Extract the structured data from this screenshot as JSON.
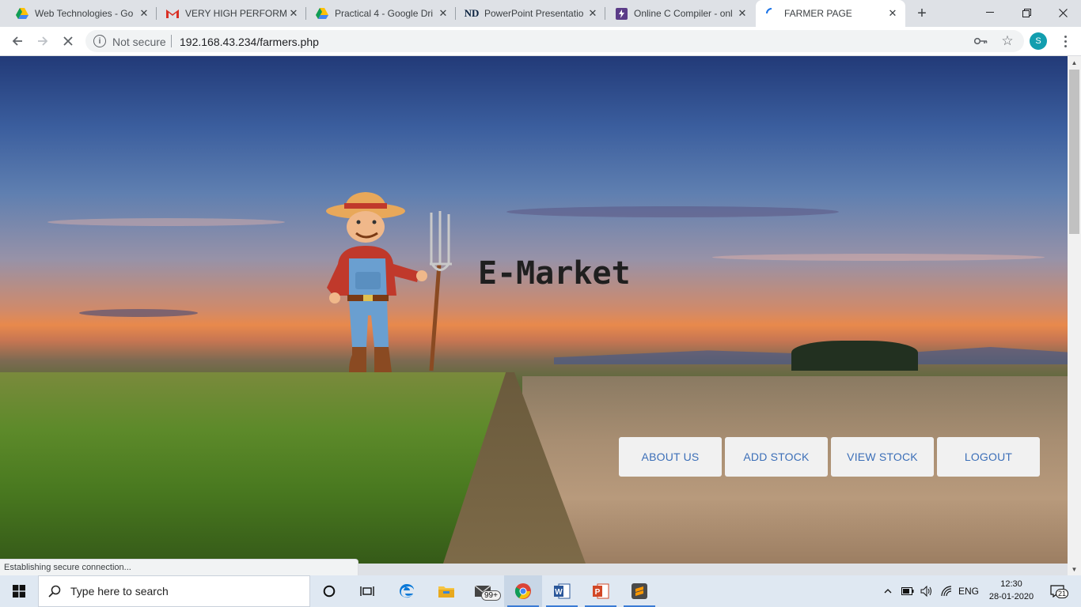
{
  "browser": {
    "tabs": [
      {
        "title": "Web Technologies - Go",
        "icon": "google-drive-icon"
      },
      {
        "title": "VERY HIGH PERFORMA",
        "icon": "gmail-icon"
      },
      {
        "title": "Practical 4 - Google Dri",
        "icon": "google-drive-icon"
      },
      {
        "title": "PowerPoint Presentatio",
        "icon": "notre-dame-icon"
      },
      {
        "title": "Online C Compiler - onl",
        "icon": "bolt-icon"
      },
      {
        "title": "FARMER PAGE",
        "icon": "loading-spinner-icon",
        "active": true
      }
    ],
    "new_tab_label": "+",
    "security_label": "Not secure",
    "url": "192.168.43.234/farmers.php",
    "profile_initial": "S",
    "status_text": "Establishing secure connection..."
  },
  "page": {
    "brand": "E-Market",
    "nav": [
      {
        "label": "ABOUT US"
      },
      {
        "label": "ADD STOCK"
      },
      {
        "label": "VIEW STOCK"
      },
      {
        "label": "LOGOUT"
      }
    ],
    "nav_color": "#3c6fb8"
  },
  "taskbar": {
    "search_placeholder": "Type here to search",
    "mail_badge": "99+",
    "language": "ENG",
    "time": "12:30",
    "date": "28-01-2020",
    "notification_count": "21"
  }
}
